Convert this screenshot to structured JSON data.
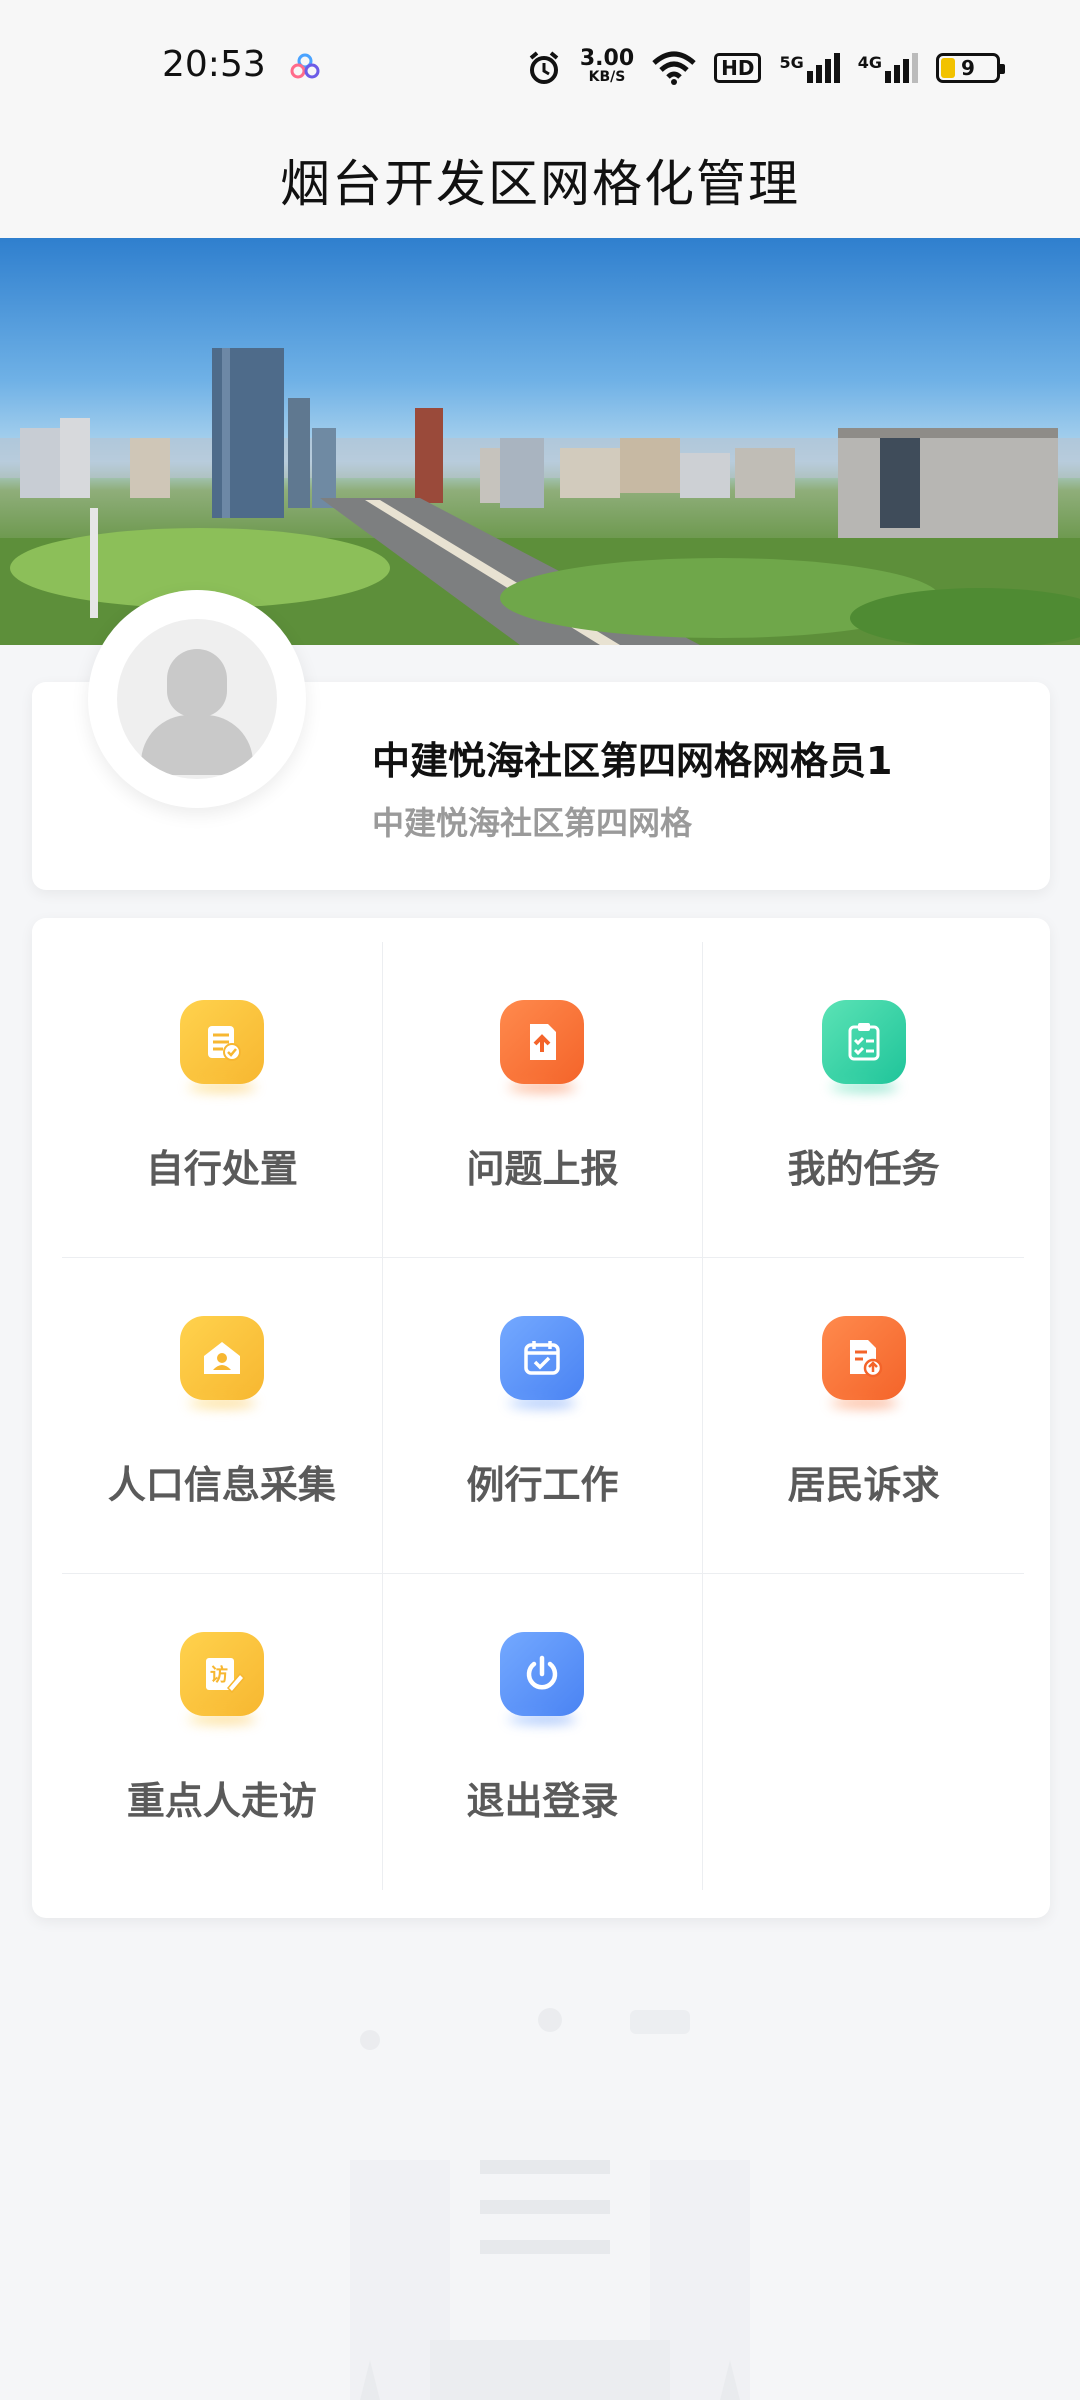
{
  "status_bar": {
    "time": "20:53",
    "network_speed_value": "3.00",
    "network_speed_unit": "KB/S",
    "hd_label": "HD",
    "sim1_label": "5G",
    "sim2_label": "4G",
    "battery": "9"
  },
  "header": {
    "title": "烟台开发区网格化管理"
  },
  "profile": {
    "name": "中建悦海社区第四网格网格员1",
    "grid": "中建悦海社区第四网格"
  },
  "menu": {
    "items": [
      {
        "label": "自行处置",
        "icon": "notes-check-icon",
        "color": "#f7b731"
      },
      {
        "label": "问题上报",
        "icon": "upload-file-icon",
        "color": "#f4642a"
      },
      {
        "label": "我的任务",
        "icon": "task-clipboard-icon",
        "color": "#1fc49a"
      },
      {
        "label": "人口信息采集",
        "icon": "house-person-icon",
        "color": "#f7b731"
      },
      {
        "label": "例行工作",
        "icon": "calendar-check-icon",
        "color": "#4a83f3"
      },
      {
        "label": "居民诉求",
        "icon": "document-upload-icon",
        "color": "#f4642a"
      },
      {
        "label": "重点人走访",
        "icon": "visit-pen-icon",
        "color": "#f7b731"
      },
      {
        "label": "退出登录",
        "icon": "power-icon",
        "color": "#4a83f3"
      }
    ],
    "visit_icon_char": "访"
  }
}
